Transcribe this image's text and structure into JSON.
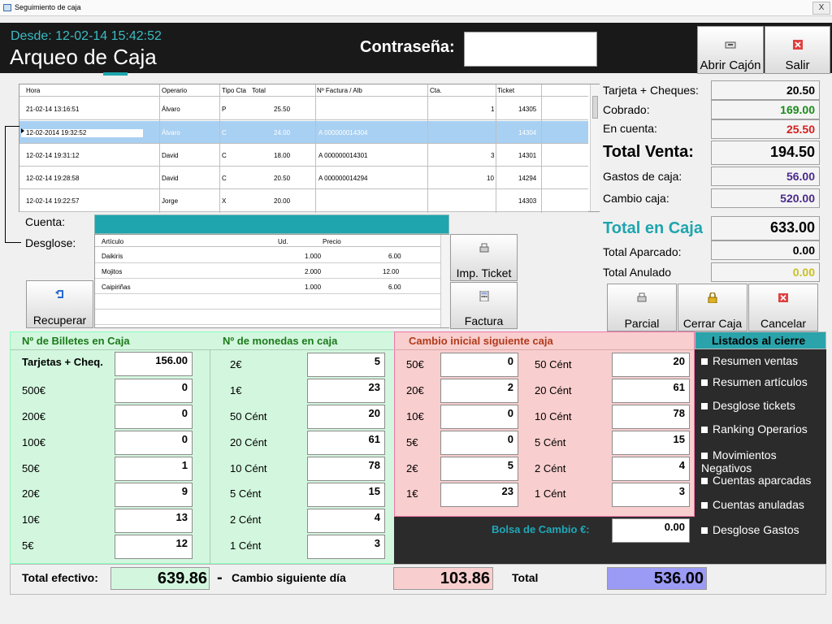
{
  "window": {
    "title": "Seguimiento de caja",
    "close": "X"
  },
  "header": {
    "desde": "Desde: 12-02-14 15:42:52",
    "title": "Arqueo de Caja",
    "password_label": "Contraseña:",
    "password_value": "",
    "buttons": {
      "abrir": "Abrir Cajón",
      "salir": "Salir"
    }
  },
  "tickets": {
    "columns": [
      "Hora",
      "Operario",
      "Tipo Cta",
      "Total",
      "Nº Factura / Alb",
      "Cta.",
      "Ticket"
    ],
    "rows": [
      [
        "21-02-14 13:16:51",
        "Álvaro",
        "P",
        "25.50",
        "",
        "1",
        "14305"
      ],
      [
        "12-02-2014 19:32:52",
        "Álvaro",
        "C",
        "24.00",
        "A 000000014304",
        "",
        "14304"
      ],
      [
        "12-02-14 19:31:12",
        "David",
        "C",
        "18.00",
        "A 000000014301",
        "3",
        "14301"
      ],
      [
        "12-02-14 19:28:58",
        "David",
        "C",
        "20.50",
        "A 000000014294",
        "10",
        "14294"
      ],
      [
        "12-02-14 19:22:57",
        "Jorge",
        "X",
        "20.00",
        "",
        "",
        "14303"
      ]
    ]
  },
  "detail": {
    "cuenta_label": "Cuenta:",
    "desglose_label": "Desglose:",
    "columns": [
      "Artículo",
      "Ud.",
      "Precio"
    ],
    "items": [
      [
        "Daikiris",
        "1.000",
        "6.00"
      ],
      [
        "Mojitos",
        "2.000",
        "12.00"
      ],
      [
        "Caipiriñas",
        "1.000",
        "6.00"
      ]
    ]
  },
  "actions": {
    "recuperar": "Recuperar",
    "imp_ticket": "Imp. Ticket",
    "factura": "Factura",
    "parcial": "Parcial",
    "cerrar_caja": "Cerrar Caja",
    "cancelar": "Cancelar"
  },
  "summary": {
    "tarjeta_label": "Tarjeta + Cheques:",
    "tarjeta": "20.50",
    "cobrado_label": "Cobrado:",
    "cobrado": "169.00",
    "cuenta_label": "En cuenta:",
    "cuenta": "25.50",
    "total_venta_label": "Total Venta:",
    "total_venta": "194.50",
    "gastos_label": "Gastos de caja:",
    "gastos": "56.00",
    "cambio_label": "Cambio caja:",
    "cambio": "520.00",
    "total_caja_label": "Total en Caja",
    "total_caja": "633.00",
    "aparcado_label": "Total Aparcado:",
    "aparcado": "0.00",
    "anulado_label": "Total Anulado",
    "anulado": "0.00"
  },
  "billetes": {
    "title": "Nº de Billetes en Caja",
    "rows": [
      {
        "label": "Tarjetas + Cheq.",
        "value": "156.00"
      },
      {
        "label": "500€",
        "value": "0"
      },
      {
        "label": "200€",
        "value": "0"
      },
      {
        "label": "100€",
        "value": "0"
      },
      {
        "label": "50€",
        "value": "1"
      },
      {
        "label": "20€",
        "value": "9"
      },
      {
        "label": "10€",
        "value": "13"
      },
      {
        "label": "5€",
        "value": "12"
      }
    ]
  },
  "monedas": {
    "title": "Nº de monedas en caja",
    "rows": [
      {
        "label": "2€",
        "value": "5"
      },
      {
        "label": "1€",
        "value": "23"
      },
      {
        "label": "50 Cént",
        "value": "20"
      },
      {
        "label": "20 Cént",
        "value": "61"
      },
      {
        "label": "10 Cént",
        "value": "78"
      },
      {
        "label": "5 Cént",
        "value": "15"
      },
      {
        "label": "2 Cént",
        "value": "4"
      },
      {
        "label": "1 Cént",
        "value": "3"
      }
    ]
  },
  "cambio_inicial": {
    "title": "Cambio inicial siguiente caja",
    "left": [
      {
        "label": "50€",
        "value": "0"
      },
      {
        "label": "20€",
        "value": "2"
      },
      {
        "label": "10€",
        "value": "0"
      },
      {
        "label": "5€",
        "value": "0"
      },
      {
        "label": "2€",
        "value": "5"
      },
      {
        "label": "1€",
        "value": "23"
      }
    ],
    "right": [
      {
        "label": "50 Cént",
        "value": "20"
      },
      {
        "label": "20 Cént",
        "value": "61"
      },
      {
        "label": "10 Cént",
        "value": "78"
      },
      {
        "label": "5 Cént",
        "value": "15"
      },
      {
        "label": "2 Cént",
        "value": "4"
      },
      {
        "label": "1 Cént",
        "value": "3"
      }
    ],
    "bolsa_label": "Bolsa de Cambio €:",
    "bolsa_value": "0.00"
  },
  "listados": {
    "title": "Listados al cierre",
    "items": [
      "Resumen ventas",
      "Resumen artículos",
      "Desglose tickets",
      "Ranking Operarios",
      "Movimientos Negativos",
      "Cuentas aparcadas",
      "Cuentas anuladas",
      "Desglose Gastos"
    ]
  },
  "footer": {
    "efectivo_label": "Total efectivo:",
    "efectivo": "639.86",
    "minus": "-",
    "cambio_label": "Cambio siguiente día",
    "cambio": "103.86",
    "total_label": "Total",
    "total": "536.00"
  },
  "colors": {
    "accent": "#1ea5ae",
    "cobrado": "#1a8a1a",
    "en_cuenta": "#d42020",
    "gastos": "#4a2a8a",
    "total_bg": "#9b9bf5",
    "green_panel": "#d3f7de",
    "pink_panel": "#f9cece",
    "bolsa_label": "#1fa8b8"
  }
}
